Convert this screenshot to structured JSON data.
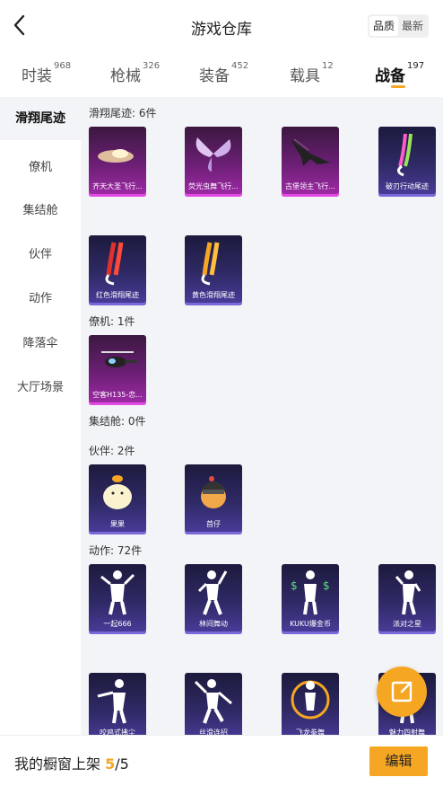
{
  "header": {
    "title": "游戏仓库",
    "sort_options": [
      "品质",
      "最新"
    ],
    "sort_selected": "品质"
  },
  "tabs": [
    {
      "label": "时装",
      "count": "968"
    },
    {
      "label": "枪械",
      "count": "326"
    },
    {
      "label": "装备",
      "count": "452"
    },
    {
      "label": "载具",
      "count": "12"
    },
    {
      "label": "战备",
      "count": "197"
    }
  ],
  "sidebar": {
    "items": [
      {
        "label": "滑翔尾迹"
      },
      {
        "label": "僚机"
      },
      {
        "label": "集结舱"
      },
      {
        "label": "伙伴"
      },
      {
        "label": "动作"
      },
      {
        "label": "降落伞"
      },
      {
        "label": "大厅场景"
      }
    ]
  },
  "sections": {
    "trail": {
      "title": "滑翔尾迹: 6件",
      "items": [
        "齐天大圣飞行...",
        "荧光虫舞飞行...",
        "古堡领主飞行...",
        "破刃行动尾迹",
        "红色滑翔尾迹",
        "黄色滑翔尾迹"
      ]
    },
    "wingman": {
      "title": "僚机: 1件",
      "items": [
        "空客H135-恋..."
      ]
    },
    "pod": {
      "title": "集结舱: 0件"
    },
    "partner": {
      "title": "伙伴: 2件",
      "items": [
        "果果",
        "首仔"
      ]
    },
    "emote": {
      "title": "动作: 72件",
      "items": [
        "一起666",
        "林间舞动",
        "KUKU爆金币",
        "派对之星",
        "咬鸡式拂尘",
        "丝滑连招",
        "飞龙拳舞",
        "魅力四射舞"
      ]
    }
  },
  "footer": {
    "label": "我的橱窗上架",
    "current": "5",
    "total": "/5",
    "edit_label": "编辑"
  },
  "colors": {
    "accent": "#f5a623",
    "card_purple": "#a12aa8",
    "card_blue": "#4a3c9c"
  }
}
